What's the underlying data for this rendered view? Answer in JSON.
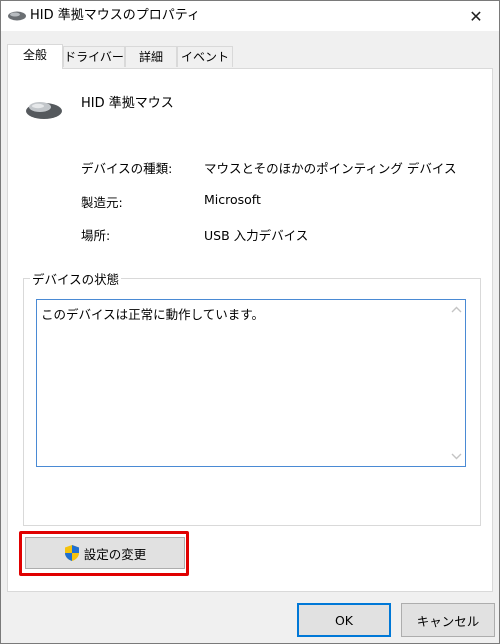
{
  "window": {
    "title": "HID 準拠マウスのプロパティ",
    "close_label": "✕"
  },
  "tabs": [
    {
      "label": "全般",
      "active": true
    },
    {
      "label": "ドライバー",
      "active": false
    },
    {
      "label": "詳細",
      "active": false
    },
    {
      "label": "イベント",
      "active": false
    }
  ],
  "device": {
    "name": "HID 準拠マウス",
    "icon": "mouse-icon"
  },
  "properties": [
    {
      "label": "デバイスの種類:",
      "value": "マウスとそのほかのポインティング デバイス"
    },
    {
      "label": "製造元:",
      "value": "Microsoft"
    },
    {
      "label": "場所:",
      "value": "USB 入力デバイス"
    }
  ],
  "status": {
    "legend": "デバイスの状態",
    "text": "このデバイスは正常に動作しています。"
  },
  "buttons": {
    "change_settings": "設定の変更",
    "ok": "OK",
    "cancel": "キャンセル"
  },
  "colors": {
    "highlight": "#e00000",
    "focus_border": "#0078d7",
    "status_border": "#4a8ad4"
  }
}
